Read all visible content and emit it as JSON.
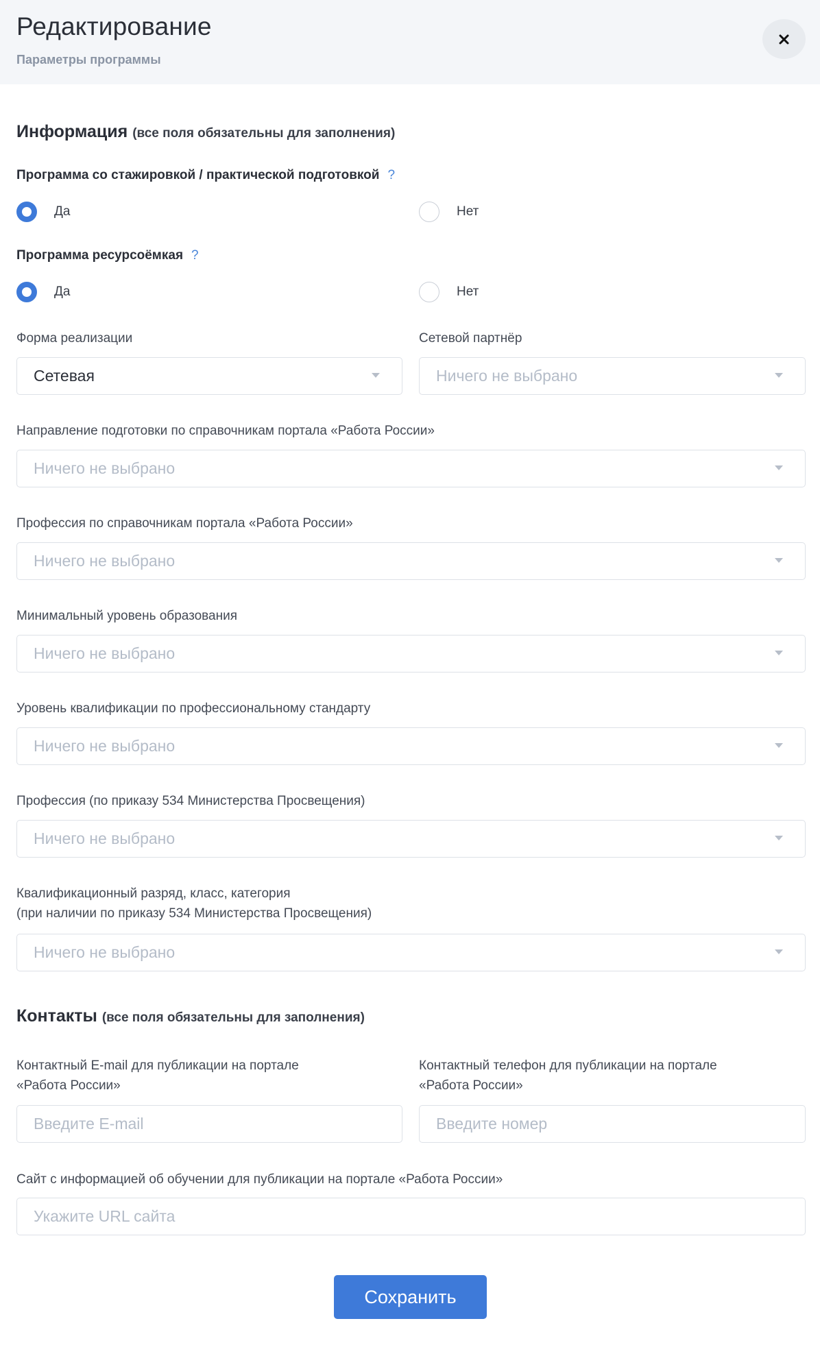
{
  "header": {
    "title": "Редактирование",
    "subtitle": "Параметры программы"
  },
  "info_section": {
    "title": "Информация",
    "note": "(все поля обязательны для заполнения)"
  },
  "internship_question": {
    "label": "Программа со стажировкой / практической подготовкой",
    "help": "?",
    "options": [
      "Да",
      "Нет"
    ],
    "selected": "Да"
  },
  "resource_question": {
    "label": "Программа ресурсоёмкая",
    "help": "?",
    "options": [
      "Да",
      "Нет"
    ],
    "selected": "Да"
  },
  "fields": {
    "form": {
      "label": "Форма реализации",
      "value": "Сетевая"
    },
    "partner": {
      "label": "Сетевой партнёр",
      "placeholder": "Ничего не выбрано"
    },
    "direction": {
      "label": "Направление подготовки по справочникам портала «Работа России»",
      "placeholder": "Ничего не выбрано"
    },
    "profession": {
      "label": "Профессия по справочникам портала «Работа России»",
      "placeholder": "Ничего не выбрано"
    },
    "education": {
      "label": "Минимальный уровень образования",
      "placeholder": "Ничего не выбрано"
    },
    "qualification": {
      "label": "Уровень квалификации по профессиональному стандарту",
      "placeholder": "Ничего не выбрано"
    },
    "profession534": {
      "label": "Профессия (по приказу 534 Министерства Просвещения)",
      "placeholder": "Ничего не выбрано"
    },
    "grade": {
      "label_line1": "Квалификационный разряд, класс, категория",
      "label_line2": "(при наличии по приказу 534 Министерства Просвещения)",
      "placeholder": "Ничего не выбрано"
    }
  },
  "contacts_section": {
    "title": "Контакты",
    "note": "(все поля обязательны для заполнения)"
  },
  "contacts": {
    "email": {
      "label_line1": "Контактный E-mail для публикации на портале",
      "label_line2": "«Работа России»",
      "placeholder": "Введите E-mail"
    },
    "phone": {
      "label_line1": "Контактный телефон для публикации на портале",
      "label_line2": "«Работа России»",
      "placeholder": "Введите номер"
    },
    "site": {
      "label": "Сайт с информацией об обучении для публикации на портале «Работа России»",
      "placeholder": "Укажите URL сайта"
    }
  },
  "save_label": "Сохранить",
  "colors": {
    "accent": "#3e7ad9",
    "header_bg": "#f4f6f9",
    "placeholder": "#b4bcc8"
  }
}
